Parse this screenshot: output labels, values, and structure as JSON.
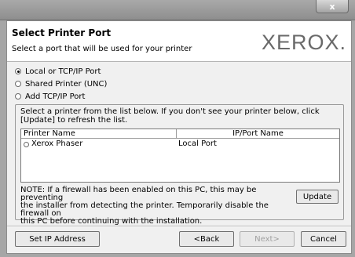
{
  "window": {
    "close_label": "x"
  },
  "header": {
    "title": "Select Printer Port",
    "subtitle": "Select a port that will be used for your printer",
    "logo": "XEROX."
  },
  "port_options": [
    {
      "label": "Local or TCP/IP Port",
      "selected": true
    },
    {
      "label": "Shared Printer (UNC)",
      "selected": false
    },
    {
      "label": "Add TCP/IP Port",
      "selected": false
    }
  ],
  "printer_list": {
    "instruction_line1": "Select a printer from the list below. If you don't see your printer below, click",
    "instruction_line2": "[Update] to refresh the list.",
    "columns": [
      "Printer Name",
      "IP/Port Name"
    ],
    "rows": [
      {
        "name": "Xerox Phaser",
        "port": "Local Port",
        "selected": false
      }
    ]
  },
  "note": {
    "line1": "NOTE: If a firewall has been enabled on this PC, this may be preventing",
    "line2": "the installer from detecting the printer. Temporarily disable the firewall on",
    "line3": "this PC before continuing with the installation."
  },
  "buttons": {
    "update": "Update",
    "set_ip": "Set IP Address",
    "back": "<Back",
    "next": "Next>",
    "cancel": "Cancel"
  }
}
